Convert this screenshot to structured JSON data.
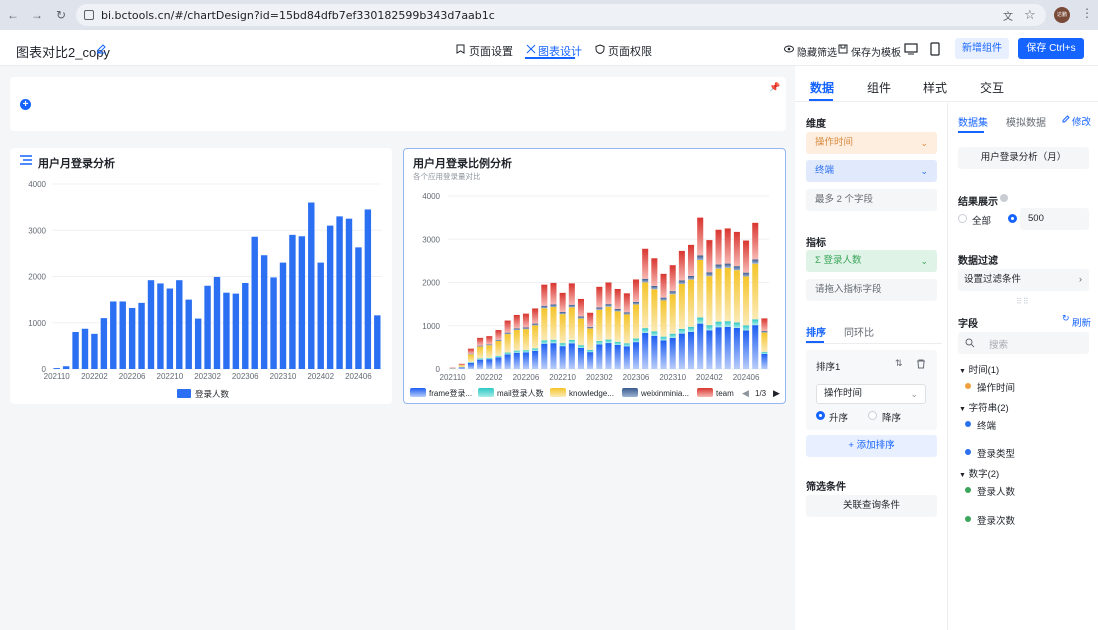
{
  "browser": {
    "url": "bi.bctools.cn/#/chartDesign?id=15bd84dfb7ef330182599b343d7aab1c",
    "avatar": "达鹏"
  },
  "header": {
    "title": "图表对比2_copy",
    "tabs": [
      {
        "label": "页面设置"
      },
      {
        "label": "图表设计"
      },
      {
        "label": "页面权限"
      }
    ],
    "hide_filter": "隐藏筛选",
    "save_template": "保存为模板",
    "add_component": "新增组件",
    "save": "保存 Ctrl+s"
  },
  "chart1": {
    "title": "用户月登录分析",
    "legend": "登录人数",
    "y_ticks": [
      "0",
      "1000",
      "2000",
      "3000",
      "4000"
    ],
    "x_ticks": [
      "202110",
      "202202",
      "202206",
      "202210",
      "202302",
      "202306",
      "202310",
      "202402",
      "202406"
    ]
  },
  "chart2": {
    "title": "用户月登录比例分析",
    "subtitle": "各个应用登录量对比",
    "y_ticks": [
      "0",
      "1000",
      "2000",
      "3000",
      "4000"
    ],
    "x_ticks": [
      "202110",
      "202202",
      "202206",
      "202210",
      "202302",
      "202306",
      "202310",
      "202402",
      "202406"
    ],
    "legend": [
      "frame登录...",
      "mail登录人数",
      "knowledge...",
      "weixinminia...",
      "team"
    ],
    "legend_page": "1/3"
  },
  "chart_data": [
    {
      "type": "bar",
      "title": "用户月登录分析",
      "ylim": [
        0,
        4000
      ],
      "categories": [
        "202110",
        "202111",
        "202112",
        "202201",
        "202202",
        "202203",
        "202204",
        "202205",
        "202206",
        "202207",
        "202208",
        "202209",
        "202210",
        "202211",
        "202212",
        "202301",
        "202302",
        "202303",
        "202304",
        "202305",
        "202306",
        "202307",
        "202308",
        "202309",
        "202310",
        "202311",
        "202312",
        "202401",
        "202402",
        "202403",
        "202404",
        "202405",
        "202406",
        "202407"
      ],
      "series": [
        {
          "name": "登录人数",
          "values": [
            20,
            60,
            800,
            870,
            760,
            1100,
            1460,
            1460,
            1320,
            1430,
            1920,
            1850,
            1740,
            1920,
            1500,
            1090,
            1800,
            1990,
            1650,
            1630,
            1860,
            2860,
            2460,
            1980,
            2300,
            2900,
            2870,
            3600,
            2300,
            3100,
            3300,
            3250,
            2630,
            3450,
            1160
          ]
        }
      ]
    },
    {
      "type": "bar",
      "title": "用户月登录比例分析",
      "ylim": [
        0,
        4000
      ],
      "categories": [
        "202110",
        "202111",
        "202112",
        "202201",
        "202202",
        "202203",
        "202204",
        "202205",
        "202206",
        "202207",
        "202208",
        "202209",
        "202210",
        "202211",
        "202212",
        "202301",
        "202302",
        "202303",
        "202304",
        "202305",
        "202306",
        "202307",
        "202308",
        "202309",
        "202310",
        "202311",
        "202312",
        "202401",
        "202402",
        "202403",
        "202404",
        "202405",
        "202406",
        "202407"
      ],
      "stacked_totals": [
        30,
        120,
        470,
        720,
        760,
        900,
        1120,
        1250,
        1280,
        1400,
        1950,
        1990,
        1760,
        1980,
        1620,
        1300,
        1900,
        2000,
        1850,
        1750,
        2070,
        2780,
        2560,
        2200,
        2400,
        2730,
        2870,
        3500,
        2980,
        3220,
        3250,
        3170,
        2970,
        3380,
        1170
      ],
      "series": [
        {
          "name": "frame登录...",
          "share": 0.3
        },
        {
          "name": "mail登录人数",
          "share": 0.04
        },
        {
          "name": "knowledge...",
          "share": 0.38
        },
        {
          "name": "weixinminia...",
          "share": 0.03
        },
        {
          "name": "team",
          "share": 0.25
        }
      ]
    }
  ],
  "panel": {
    "tabs": [
      "数据",
      "组件",
      "样式",
      "交互"
    ],
    "dimension_label": "维度",
    "dimensions": [
      "操作时间",
      "终端"
    ],
    "dimension_hint": "最多 2 个字段",
    "metric_label": "指标",
    "metric": "Σ 登录人数",
    "metric_hint": "请拖入指标字段",
    "sort_tabs": [
      "排序",
      "同环比"
    ],
    "sort_name": "排序1",
    "sort_field": "操作时间",
    "asc": "升序",
    "desc": "降序",
    "add_sort": "+ 添加排序",
    "filter_label": "筛选条件",
    "filter_button": "关联查询条件",
    "dataset_tabs": [
      "数据集",
      "模拟数据"
    ],
    "edit": "修改",
    "dataset_name": "用户登录分析（月）",
    "result_label": "结果展示",
    "result_all": "全部",
    "result_count": "500",
    "data_filter_label": "数据过滤",
    "data_filter_btn": "设置过滤条件",
    "fields_label": "字段",
    "refresh": "刷新",
    "search_placeholder": "搜索",
    "groups": [
      {
        "label": "时间(1)",
        "items": [
          {
            "name": "操作时间",
            "color": "#f0a03c"
          }
        ]
      },
      {
        "label": "字符串(2)",
        "items": [
          {
            "name": "终端",
            "color": "#2b6ff2"
          },
          {
            "name": "登录类型",
            "color": "#2b6ff2"
          }
        ]
      },
      {
        "label": "数字(2)",
        "items": [
          {
            "name": "登录人数",
            "color": "#3aa55b"
          },
          {
            "name": "登录次数",
            "color": "#3aa55b"
          }
        ]
      }
    ]
  }
}
